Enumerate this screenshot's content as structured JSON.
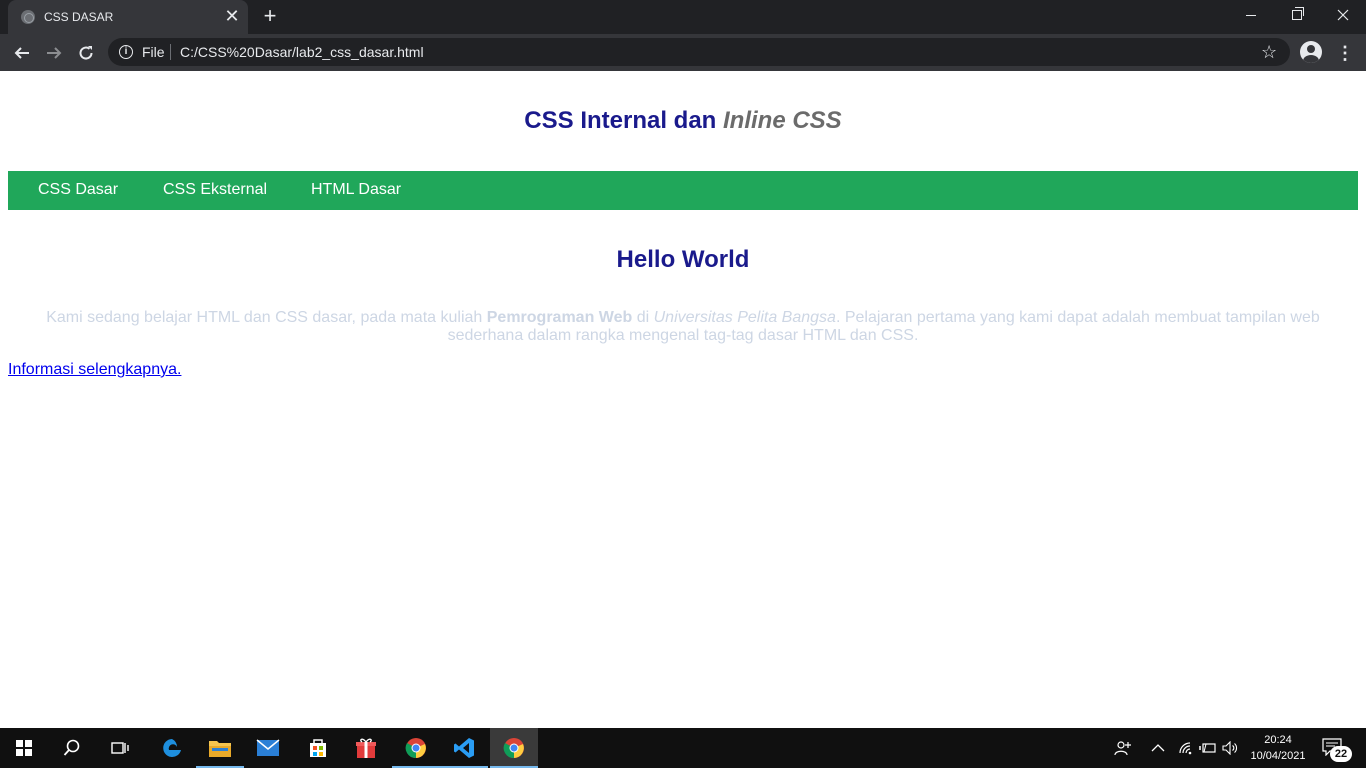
{
  "browser": {
    "tab_title": "CSS DASAR",
    "tab_close": "✕",
    "new_tab": "+",
    "url_label": "File",
    "url": "C:/CSS%20Dasar/lab2_css_dasar.html",
    "icons": [
      "back-arrow-icon",
      "forward-arrow-icon",
      "reload-icon",
      "info-icon",
      "star-icon",
      "profile-icon",
      "menu-icon"
    ]
  },
  "page": {
    "title_normal": "CSS Internal dan ",
    "title_italic": "Inline CSS",
    "menu": [
      {
        "label": "CSS Dasar"
      },
      {
        "label": "CSS Eksternal"
      },
      {
        "label": "HTML Dasar"
      }
    ],
    "heading": "Hello World",
    "paragraph": {
      "part1": "Kami sedang belajar HTML dan CSS dasar, pada mata kuliah ",
      "bold": "Pemrograman Web",
      "part2": " di ",
      "italic": "Universitas Pelita Bangsa",
      "part3": ". Pelajaran pertama yang kami dapat adalah membuat tampilan web sederhana dalam rangka mengenal tag-tag dasar HTML dan CSS."
    },
    "link": "Informasi selengkapnya."
  },
  "taskbar": {
    "time": "20:24",
    "date": "10/04/2021",
    "notifications": "22"
  },
  "colors": {
    "title_blue": "#1a1a8c",
    "menu_green": "#20a75a",
    "paragraph_gray": "#cdd6e4"
  }
}
